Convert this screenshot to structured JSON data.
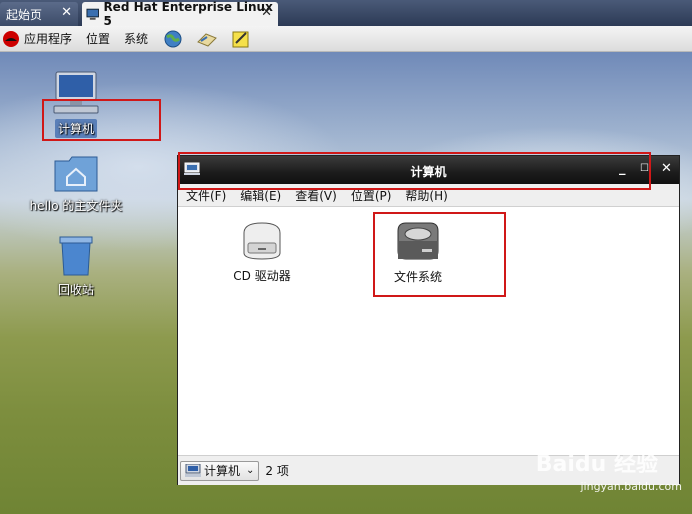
{
  "tabs": [
    {
      "label": "起始页",
      "active": false
    },
    {
      "label": "Red Hat Enterprise Linux 5",
      "active": true
    }
  ],
  "panel": {
    "menus": [
      "应用程序",
      "位置",
      "系统"
    ],
    "launchers": [
      "globe-icon",
      "mail-icon",
      "notes-icon"
    ]
  },
  "desktop": {
    "icons": [
      {
        "label": "计算机",
        "icon": "computer-icon",
        "selected": true
      },
      {
        "label": "hello 的主文件夹",
        "icon": "home-folder-icon",
        "selected": false
      },
      {
        "label": "回收站",
        "icon": "trash-icon",
        "selected": false
      }
    ]
  },
  "window": {
    "title": "计算机",
    "menus": [
      "文件(F)",
      "编辑(E)",
      "查看(V)",
      "位置(P)",
      "帮助(H)"
    ],
    "items": [
      {
        "label": "CD 驱动器",
        "icon": "cd-drive-icon"
      },
      {
        "label": "文件系统",
        "icon": "hard-disk-icon"
      }
    ],
    "location_combo": "计算机",
    "item_count": "2 项"
  },
  "watermark": {
    "brand": "Baidu 经验",
    "url": "jingyan.baidu.com"
  },
  "colors": {
    "annotation_red": "#d01818",
    "selection_blue": "#5a7fb8",
    "titlebar": "#1c1c1c"
  }
}
